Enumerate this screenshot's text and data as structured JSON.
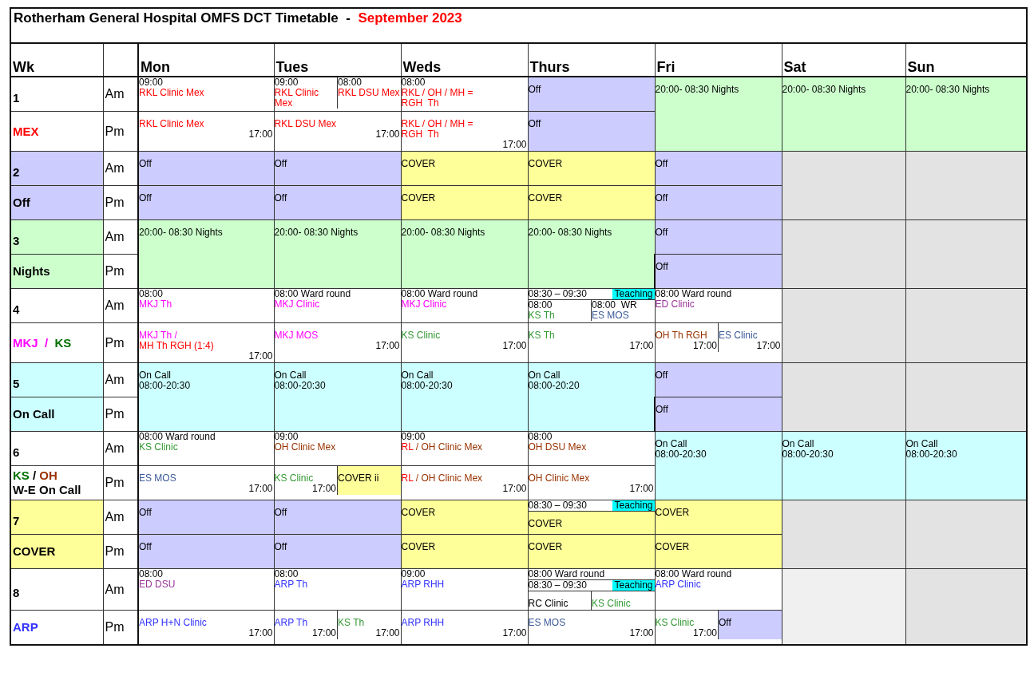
{
  "title": {
    "text": "Rotherham General Hospital OMFS DCT Timetable  -  ",
    "highlight": "September 2023"
  },
  "columns": {
    "week": "Wk",
    "days": [
      "Mon",
      "Tues",
      "Weds",
      "Thurs",
      "Fri",
      "Sat",
      "Sun"
    ]
  },
  "weeks": [
    {
      "number": "1",
      "kind": "plain",
      "labels": [
        [
          {
            "text": "MEX",
            "color": "#ff0000"
          }
        ]
      ],
      "am": {
        "label": "Am",
        "cells": [
          {
            "full_day": false,
            "kind": "plain",
            "lines": [
              {
                "kind": "time",
                "text": "09:00"
              },
              {
                "kind": "text",
                "text": "RKL Clinic Mex",
                "color": "#ff0000"
              }
            ]
          },
          {
            "full_day": false,
            "kind": "plain",
            "bands": [
              {
                "parts": [
                  {
                    "lines": [
                      {
                        "kind": "time",
                        "text": "09:00"
                      },
                      {
                        "kind": "text",
                        "text": "RKL Clinic Mex",
                        "color": "#ff0000"
                      }
                    ]
                  },
                  {
                    "lines": [
                      {
                        "kind": "time",
                        "text": "08:00"
                      },
                      {
                        "kind": "text",
                        "text": "RKL DSU Mex",
                        "color": "#ff0000"
                      }
                    ]
                  }
                ]
              }
            ]
          },
          {
            "full_day": false,
            "kind": "plain",
            "lines": [
              {
                "kind": "time",
                "text": "08:00"
              },
              {
                "kind": "text",
                "text": "RKL / OH / MH =",
                "color": "#ff0000"
              },
              {
                "kind": "text",
                "text": "RGH  Th",
                "color": "#ff0000"
              }
            ]
          },
          {
            "full_day": false,
            "kind": "off",
            "lines": [
              {
                "kind": "text",
                "text": "Off"
              }
            ]
          },
          {
            "full_day": true,
            "kind": "nights",
            "lines": [
              {
                "kind": "text",
                "text": "20:00- 08:30 Nights"
              }
            ]
          },
          {
            "full_day": true,
            "kind": "nights",
            "lines": [
              {
                "kind": "text",
                "text": "20:00- 08:30 Nights"
              }
            ]
          },
          {
            "full_day": true,
            "kind": "nights",
            "lines": [
              {
                "kind": "text",
                "text": "20:00- 08:30 Nights"
              }
            ]
          }
        ]
      },
      "pm": {
        "label": "Pm",
        "cells": [
          {
            "full_day": false,
            "kind": "plain",
            "lines": [
              {
                "kind": "text",
                "text": "RKL Clinic Mex",
                "color": "#ff0000"
              },
              {
                "kind": "end",
                "text": "17:00"
              }
            ]
          },
          {
            "full_day": false,
            "kind": "plain",
            "lines": [
              {
                "kind": "text",
                "text": "RKL DSU Mex",
                "color": "#ff0000"
              },
              {
                "kind": "end",
                "text": "17:00"
              }
            ]
          },
          {
            "full_day": false,
            "kind": "plain",
            "lines": [
              {
                "kind": "text",
                "text": "RKL / OH / MH =",
                "color": "#ff0000"
              },
              {
                "kind": "text",
                "text": "RGH  Th",
                "color": "#ff0000"
              },
              {
                "kind": "end",
                "text": "17:00"
              }
            ]
          },
          {
            "full_day": false,
            "kind": "off",
            "lines": [
              {
                "kind": "text",
                "text": "Off"
              }
            ]
          }
        ]
      }
    },
    {
      "number": "2",
      "kind": "off",
      "labels": [
        [
          {
            "text": "Off"
          }
        ]
      ],
      "am": {
        "label": "Am",
        "cells": [
          {
            "full_day": false,
            "kind": "off",
            "lines": [
              {
                "kind": "text",
                "text": "Off"
              }
            ]
          },
          {
            "full_day": false,
            "kind": "off",
            "lines": [
              {
                "kind": "text",
                "text": "Off"
              }
            ]
          },
          {
            "full_day": false,
            "kind": "cover",
            "lines": [
              {
                "kind": "text",
                "text": "COVER"
              }
            ]
          },
          {
            "full_day": false,
            "kind": "cover",
            "lines": [
              {
                "kind": "text",
                "text": "COVER"
              }
            ]
          },
          {
            "full_day": false,
            "kind": "off",
            "lines": [
              {
                "kind": "text",
                "text": "Off"
              }
            ]
          },
          {
            "full_day": true,
            "kind": "blank"
          },
          {
            "full_day": true,
            "kind": "blank"
          }
        ]
      },
      "pm": {
        "label": "Pm",
        "cells": [
          {
            "full_day": false,
            "kind": "off",
            "lines": [
              {
                "kind": "text",
                "text": "Off"
              }
            ]
          },
          {
            "full_day": false,
            "kind": "off",
            "lines": [
              {
                "kind": "text",
                "text": "Off"
              }
            ]
          },
          {
            "full_day": false,
            "kind": "cover",
            "lines": [
              {
                "kind": "text",
                "text": "COVER"
              }
            ]
          },
          {
            "full_day": false,
            "kind": "cover",
            "lines": [
              {
                "kind": "text",
                "text": "COVER"
              }
            ]
          },
          {
            "full_day": false,
            "kind": "off",
            "lines": [
              {
                "kind": "text",
                "text": "Off"
              }
            ]
          }
        ]
      }
    },
    {
      "number": "3",
      "kind": "nights",
      "labels": [
        [
          {
            "text": "Nights"
          }
        ]
      ],
      "am": {
        "label": "Am",
        "cells": [
          {
            "full_day": true,
            "kind": "nights",
            "lines": [
              {
                "kind": "text",
                "text": "20:00- 08:30 Nights"
              }
            ]
          },
          {
            "full_day": true,
            "kind": "nights",
            "lines": [
              {
                "kind": "text",
                "text": "20:00- 08:30 Nights"
              }
            ]
          },
          {
            "full_day": true,
            "kind": "nights",
            "lines": [
              {
                "kind": "text",
                "text": "20:00- 08:30 Nights"
              }
            ]
          },
          {
            "full_day": true,
            "kind": "nights",
            "lines": [
              {
                "kind": "text",
                "text": "20:00- 08:30 Nights"
              }
            ]
          },
          {
            "full_day": false,
            "kind": "off",
            "lines": [
              {
                "kind": "text",
                "text": "Off"
              }
            ]
          },
          {
            "full_day": true,
            "kind": "blank"
          },
          {
            "full_day": true,
            "kind": "blank"
          }
        ]
      },
      "pm": {
        "label": "Pm",
        "cells": [
          {
            "full_day": false,
            "kind": "off",
            "lines": [
              {
                "kind": "text",
                "text": "Off"
              }
            ]
          }
        ]
      }
    },
    {
      "number": "4",
      "kind": "plain",
      "labels": [
        [
          {
            "text": "MKJ",
            "color": "#ff00ff"
          },
          {
            "text": "  /  ",
            "color": "#ff00ff"
          },
          {
            "text": "KS",
            "color": "#007000"
          }
        ]
      ],
      "am": {
        "label": "Am",
        "cells": [
          {
            "full_day": false,
            "kind": "plain",
            "lines": [
              {
                "kind": "time",
                "text": "08:00"
              },
              {
                "kind": "text",
                "text": "MKJ Th",
                "color": "#ff00ff"
              }
            ]
          },
          {
            "full_day": false,
            "kind": "plain",
            "lines": [
              {
                "kind": "time",
                "text": "08:00 Ward round"
              },
              {
                "kind": "text",
                "text": "MKJ Clinic",
                "color": "#ff00ff"
              }
            ]
          },
          {
            "full_day": false,
            "kind": "plain",
            "lines": [
              {
                "kind": "time",
                "text": "08:00 Ward round"
              },
              {
                "kind": "text",
                "text": "MKJ Clinic",
                "color": "#ff00ff"
              }
            ]
          },
          {
            "full_day": false,
            "kind": "plain",
            "bands": [
              {
                "parts": [
                  {
                    "lines": [
                      {
                        "kind": "slot",
                        "text": "08:30 – 09:30",
                        "badge": "Teaching"
                      }
                    ]
                  }
                ]
              },
              {
                "parts": [
                  {
                    "lines": [
                      {
                        "kind": "time",
                        "text": "08:00"
                      },
                      {
                        "kind": "text",
                        "text": "KS Th",
                        "color": "#339933"
                      }
                    ]
                  },
                  {
                    "lines": [
                      {
                        "kind": "time",
                        "text": "08:00  WR"
                      },
                      {
                        "kind": "text",
                        "text": "ES MOS",
                        "color": "#3b5998"
                      }
                    ]
                  }
                ]
              }
            ]
          },
          {
            "full_day": false,
            "kind": "plain",
            "lines": [
              {
                "kind": "time",
                "text": "08:00 Ward round"
              },
              {
                "kind": "text",
                "text": "ED Clinic",
                "color": "#993399"
              }
            ]
          },
          {
            "full_day": true,
            "kind": "blank"
          },
          {
            "full_day": true,
            "kind": "blank"
          }
        ]
      },
      "pm": {
        "label": "Pm",
        "cells": [
          {
            "full_day": false,
            "kind": "plain",
            "lines": [
              {
                "kind": "text",
                "text": "MKJ Th /",
                "color": "#ff00ff"
              },
              {
                "kind": "text",
                "text": "MH Th RGH (1:4)",
                "color": "#ff0000"
              },
              {
                "kind": "end",
                "text": "17:00"
              }
            ]
          },
          {
            "full_day": false,
            "kind": "plain",
            "lines": [
              {
                "kind": "text",
                "text": "MKJ MOS",
                "color": "#ff00ff"
              },
              {
                "kind": "end",
                "text": "17:00"
              }
            ]
          },
          {
            "full_day": false,
            "kind": "plain",
            "lines": [
              {
                "kind": "text",
                "text": "KS Clinic",
                "color": "#339933"
              },
              {
                "kind": "end",
                "text": "17:00"
              }
            ]
          },
          {
            "full_day": false,
            "kind": "plain",
            "lines": [
              {
                "kind": "text",
                "text": "KS Th",
                "color": "#339933"
              },
              {
                "kind": "end",
                "text": "17:00"
              }
            ]
          },
          {
            "full_day": false,
            "kind": "plain",
            "bands": [
              {
                "parts": [
                  {
                    "lines": [
                      {
                        "kind": "text",
                        "text": "OH Th RGH",
                        "color": "#993300"
                      },
                      {
                        "kind": "end",
                        "text": "17:00"
                      }
                    ]
                  },
                  {
                    "lines": [
                      {
                        "kind": "text",
                        "text": "ES Clinic",
                        "color": "#3b5998"
                      },
                      {
                        "kind": "end",
                        "text": "17:00"
                      }
                    ]
                  }
                ]
              }
            ]
          }
        ]
      }
    },
    {
      "number": "5",
      "kind": "oncall",
      "labels": [
        [
          {
            "text": "On Call"
          }
        ]
      ],
      "am": {
        "label": "Am",
        "cells": [
          {
            "full_day": true,
            "kind": "oncall",
            "lines": [
              {
                "kind": "text",
                "text": "On Call"
              },
              {
                "kind": "text",
                "text": "08:00-20:30"
              }
            ]
          },
          {
            "full_day": true,
            "kind": "oncall",
            "lines": [
              {
                "kind": "text",
                "text": "On Call"
              },
              {
                "kind": "text",
                "text": "08:00-20:30"
              }
            ]
          },
          {
            "full_day": true,
            "kind": "oncall",
            "lines": [
              {
                "kind": "text",
                "text": "On Call"
              },
              {
                "kind": "text",
                "text": "08:00-20:30"
              }
            ]
          },
          {
            "full_day": true,
            "kind": "oncall",
            "lines": [
              {
                "kind": "text",
                "text": "On Call"
              },
              {
                "kind": "text",
                "text": "08:00-20:20"
              }
            ]
          },
          {
            "full_day": false,
            "kind": "off",
            "lines": [
              {
                "kind": "text",
                "text": "Off"
              }
            ]
          },
          {
            "full_day": true,
            "kind": "blank"
          },
          {
            "full_day": true,
            "kind": "blank"
          }
        ]
      },
      "pm": {
        "label": "Pm",
        "cells": [
          {
            "full_day": false,
            "kind": "off",
            "lines": [
              {
                "kind": "text",
                "text": "Off"
              }
            ]
          }
        ]
      }
    },
    {
      "number": "6",
      "kind": "plain",
      "labels": [
        [
          {
            "text": "KS",
            "color": "#007000"
          },
          {
            "text": " / "
          },
          {
            "text": "OH",
            "color": "#993300"
          }
        ],
        [
          {
            "text": "W-E On Call"
          }
        ]
      ],
      "am": {
        "label": "Am",
        "cells": [
          {
            "full_day": false,
            "kind": "plain",
            "lines": [
              {
                "kind": "time",
                "text": "08:00 Ward round"
              },
              {
                "kind": "text",
                "text": "KS Clinic",
                "color": "#339933"
              }
            ]
          },
          {
            "full_day": false,
            "kind": "plain",
            "lines": [
              {
                "kind": "time",
                "text": "09:00"
              },
              {
                "kind": "text",
                "text": "OH Clinic Mex",
                "color": "#993300"
              }
            ]
          },
          {
            "full_day": false,
            "kind": "plain",
            "lines": [
              {
                "kind": "time",
                "text": "09:00"
              },
              {
                "kind": "mixed",
                "segments": [
                  {
                    "text": "RL",
                    "color": "#ff0000"
                  },
                  {
                    "text": " / OH Clinic Mex",
                    "color": "#993300"
                  }
                ]
              }
            ]
          },
          {
            "full_day": false,
            "kind": "plain",
            "lines": [
              {
                "kind": "time",
                "text": "08:00"
              },
              {
                "kind": "text",
                "text": "OH DSU Mex",
                "color": "#993300"
              }
            ]
          },
          {
            "full_day": true,
            "kind": "oncall",
            "lines": [
              {
                "kind": "text",
                "text": "On Call"
              },
              {
                "kind": "text",
                "text": "08:00-20:30"
              }
            ]
          },
          {
            "full_day": true,
            "kind": "oncall",
            "lines": [
              {
                "kind": "text",
                "text": "On Call"
              },
              {
                "kind": "text",
                "text": "08:00-20:30"
              }
            ]
          },
          {
            "full_day": true,
            "kind": "oncall",
            "lines": [
              {
                "kind": "text",
                "text": "On Call"
              },
              {
                "kind": "text",
                "text": "08:00-20:30"
              }
            ]
          }
        ]
      },
      "pm": {
        "label": "Pm",
        "cells": [
          {
            "full_day": false,
            "kind": "plain",
            "lines": [
              {
                "kind": "text",
                "text": "ES MOS",
                "color": "#3b5998"
              },
              {
                "kind": "end",
                "text": "17:00"
              }
            ]
          },
          {
            "full_day": false,
            "kind": "plain",
            "bands": [
              {
                "parts": [
                  {
                    "lines": [
                      {
                        "kind": "text",
                        "text": "KS Clinic",
                        "color": "#339933"
                      },
                      {
                        "kind": "end",
                        "text": "17:00"
                      }
                    ]
                  },
                  {
                    "kind": "cover",
                    "lines": [
                      {
                        "kind": "text",
                        "text": "COVER ii"
                      }
                    ]
                  }
                ]
              }
            ]
          },
          {
            "full_day": false,
            "kind": "plain",
            "lines": [
              {
                "kind": "mixed",
                "segments": [
                  {
                    "text": "RL",
                    "color": "#ff0000"
                  },
                  {
                    "text": " / OH Clinic Mex",
                    "color": "#993300"
                  }
                ]
              },
              {
                "kind": "end",
                "text": "17:00"
              }
            ]
          },
          {
            "full_day": false,
            "kind": "plain",
            "lines": [
              {
                "kind": "text",
                "text": "OH Clinic Mex",
                "color": "#993300"
              },
              {
                "kind": "end",
                "text": "17:00"
              }
            ]
          }
        ]
      }
    },
    {
      "number": "7",
      "kind": "cover",
      "labels": [
        [
          {
            "text": "COVER"
          }
        ]
      ],
      "am": {
        "label": "Am",
        "cells": [
          {
            "full_day": false,
            "kind": "off",
            "lines": [
              {
                "kind": "text",
                "text": "Off"
              }
            ]
          },
          {
            "full_day": false,
            "kind": "off",
            "lines": [
              {
                "kind": "text",
                "text": "Off"
              }
            ]
          },
          {
            "full_day": false,
            "kind": "cover",
            "lines": [
              {
                "kind": "text",
                "text": "COVER"
              }
            ]
          },
          {
            "full_day": false,
            "kind": "cover",
            "bands": [
              {
                "parts": [
                  {
                    "kind": "plain",
                    "lines": [
                      {
                        "kind": "slot",
                        "text": "08:30 – 09:30",
                        "badge": "Teaching"
                      }
                    ]
                  }
                ]
              },
              {
                "parts": [
                  {
                    "lines": [
                      {
                        "kind": "text",
                        "text": "COVER"
                      }
                    ]
                  }
                ]
              }
            ]
          },
          {
            "full_day": false,
            "kind": "cover",
            "lines": [
              {
                "kind": "text",
                "text": "COVER"
              }
            ]
          },
          {
            "full_day": true,
            "kind": "blank"
          },
          {
            "full_day": true,
            "kind": "blank"
          }
        ]
      },
      "pm": {
        "label": "Pm",
        "cells": [
          {
            "full_day": false,
            "kind": "off",
            "lines": [
              {
                "kind": "text",
                "text": "Off"
              }
            ]
          },
          {
            "full_day": false,
            "kind": "off",
            "lines": [
              {
                "kind": "text",
                "text": "Off"
              }
            ]
          },
          {
            "full_day": false,
            "kind": "cover",
            "lines": [
              {
                "kind": "text",
                "text": "COVER"
              }
            ]
          },
          {
            "full_day": false,
            "kind": "cover",
            "lines": [
              {
                "kind": "text",
                "text": "COVER"
              }
            ]
          },
          {
            "full_day": false,
            "kind": "cover",
            "lines": [
              {
                "kind": "text",
                "text": "COVER"
              }
            ]
          }
        ]
      }
    },
    {
      "number": "8",
      "kind": "plain",
      "labels": [
        [
          {
            "text": "ARP",
            "color": "#3333ff"
          }
        ]
      ],
      "am": {
        "label": "Am",
        "cells": [
          {
            "full_day": false,
            "kind": "plain",
            "lines": [
              {
                "kind": "time",
                "text": "08:00"
              },
              {
                "kind": "text",
                "text": "ED DSU",
                "color": "#993399"
              }
            ]
          },
          {
            "full_day": false,
            "kind": "plain",
            "lines": [
              {
                "kind": "time",
                "text": "08:00"
              },
              {
                "kind": "text",
                "text": "ARP Th",
                "color": "#3333ff"
              }
            ]
          },
          {
            "full_day": false,
            "kind": "plain",
            "lines": [
              {
                "kind": "time",
                "text": "09:00"
              },
              {
                "kind": "text",
                "text": "ARP RHH",
                "color": "#3333ff"
              }
            ]
          },
          {
            "full_day": false,
            "kind": "plain",
            "bands": [
              {
                "parts": [
                  {
                    "lines": [
                      {
                        "kind": "time",
                        "text": "08:00 Ward round"
                      }
                    ]
                  }
                ]
              },
              {
                "parts": [
                  {
                    "lines": [
                      {
                        "kind": "slot",
                        "text": "08:30 – 09:30",
                        "badge": "Teaching"
                      }
                    ]
                  }
                ]
              },
              {
                "parts": [
                  {
                    "lines": [
                      {
                        "kind": "text",
                        "text": "RC Clinic"
                      }
                    ]
                  },
                  {
                    "lines": [
                      {
                        "kind": "text",
                        "text": "KS Clinic",
                        "color": "#339933"
                      }
                    ]
                  }
                ]
              }
            ]
          },
          {
            "full_day": false,
            "kind": "plain",
            "lines": [
              {
                "kind": "time",
                "text": "08:00 Ward round"
              },
              {
                "kind": "text",
                "text": "ARP Clinic",
                "color": "#3333ff"
              }
            ]
          },
          {
            "full_day": true,
            "kind": "pale"
          },
          {
            "full_day": true,
            "kind": "blank"
          }
        ]
      },
      "pm": {
        "label": "Pm",
        "cells": [
          {
            "full_day": false,
            "kind": "plain",
            "lines": [
              {
                "kind": "text",
                "text": "ARP H+N Clinic",
                "color": "#3333ff"
              },
              {
                "kind": "end",
                "text": "17:00"
              }
            ]
          },
          {
            "full_day": false,
            "kind": "plain",
            "bands": [
              {
                "parts": [
                  {
                    "lines": [
                      {
                        "kind": "text",
                        "text": "ARP Th",
                        "color": "#3333ff"
                      },
                      {
                        "kind": "end",
                        "text": "17:00"
                      }
                    ]
                  },
                  {
                    "lines": [
                      {
                        "kind": "text",
                        "text": "KS Th",
                        "color": "#339933"
                      },
                      {
                        "kind": "end",
                        "text": "17:00"
                      }
                    ]
                  }
                ]
              }
            ]
          },
          {
            "full_day": false,
            "kind": "plain",
            "lines": [
              {
                "kind": "text",
                "text": "ARP RHH",
                "color": "#3333ff"
              },
              {
                "kind": "end",
                "text": "17:00"
              }
            ]
          },
          {
            "full_day": false,
            "kind": "plain",
            "lines": [
              {
                "kind": "text",
                "text": "ES MOS",
                "color": "#3b5998"
              },
              {
                "kind": "end",
                "text": "17:00"
              }
            ]
          },
          {
            "full_day": false,
            "kind": "plain",
            "bands": [
              {
                "parts": [
                  {
                    "lines": [
                      {
                        "kind": "text",
                        "text": "KS Clinic",
                        "color": "#339933"
                      },
                      {
                        "kind": "end",
                        "text": "17:00"
                      }
                    ]
                  },
                  {
                    "kind": "off",
                    "lines": [
                      {
                        "kind": "text",
                        "text": "Off"
                      }
                    ]
                  }
                ]
              }
            ]
          }
        ]
      }
    }
  ]
}
